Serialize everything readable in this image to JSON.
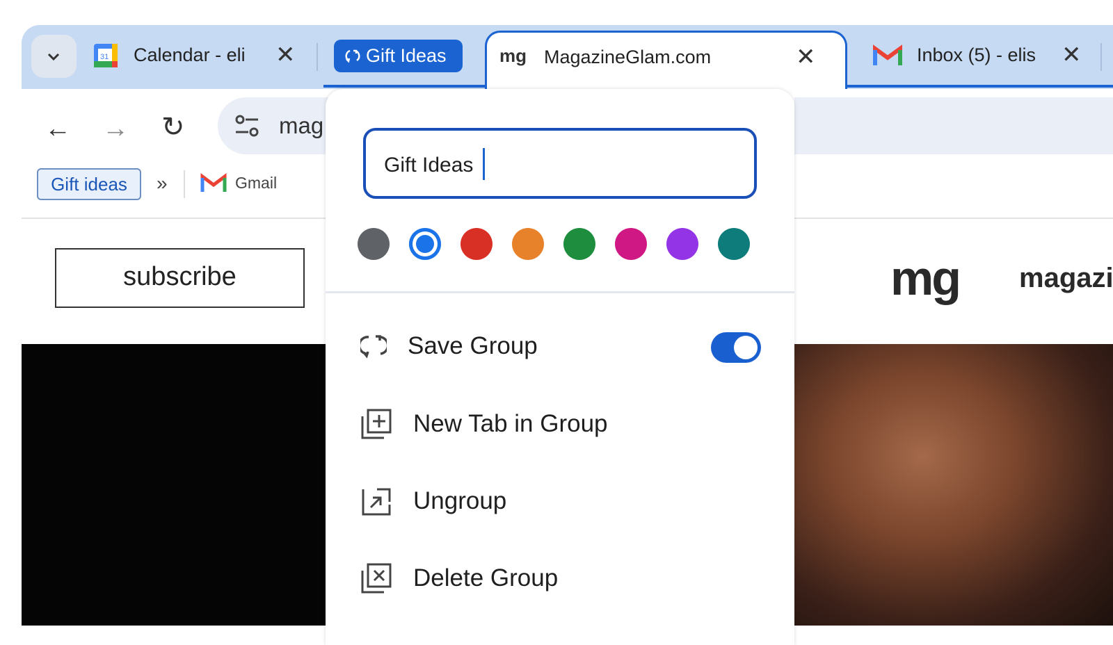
{
  "tabs": [
    {
      "title": "Calendar - eli",
      "icon": "google-calendar-icon"
    },
    {
      "title": "MagazineGlam.com",
      "icon": "magazineglam-favicon",
      "active": true
    },
    {
      "title": "Inbox (5) - elis",
      "icon": "gmail-icon"
    }
  ],
  "group_chip": {
    "label": "Gift Ideas",
    "color": "#1a63d1"
  },
  "omnibox": {
    "text": "mag"
  },
  "bookmarks": {
    "chip": "Gift ideas",
    "more": "»",
    "gmail": "Gmail"
  },
  "page": {
    "subscribe": "subscribe",
    "logo_mark": "mg",
    "logo_text": "magazi"
  },
  "popup": {
    "name_value": "Gift Ideas",
    "colors": [
      "#5f6368",
      "#1a73e8",
      "#d93025",
      "#e8822a",
      "#1e8e3e",
      "#d01884",
      "#9334e6",
      "#0f7c7c"
    ],
    "selected_color": 1,
    "items": [
      {
        "label": "Save Group",
        "icon": "save-group-icon",
        "toggle": true
      },
      {
        "label": "New Tab in Group",
        "icon": "new-tab-in-group-icon"
      },
      {
        "label": "Ungroup",
        "icon": "ungroup-icon"
      },
      {
        "label": "Delete Group",
        "icon": "delete-group-icon"
      }
    ]
  }
}
